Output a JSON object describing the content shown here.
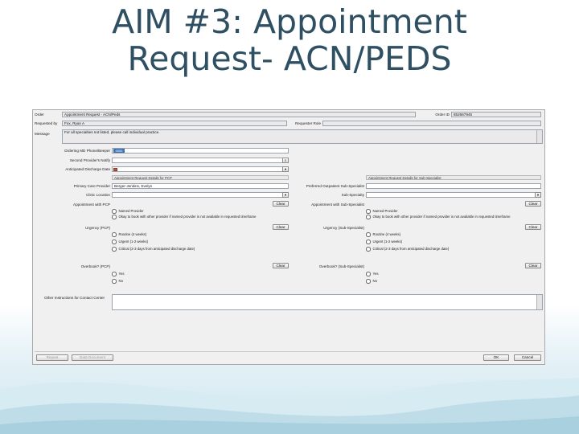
{
  "slide": {
    "title_line1": "AIM #3: Appointment",
    "title_line2": "Request- ACN/PEDS"
  },
  "form": {
    "order_label": "Order",
    "order_value": "Appointment Request - ACN/Peds",
    "order_id_label": "Order ID",
    "order_id_value": "852667945",
    "requested_by_label": "Requested by",
    "requested_by_value": "Fox, Ryan A",
    "requester_label": "Requester Role",
    "message_label": "Message",
    "message_value": "For all specialties not listed, please call individual practice.",
    "ordering_md_label": "Ordering MD Phone/Beeper",
    "ordering_md_value": "5555",
    "second_provider_label": "Second Provider's Notify",
    "anticipated_discharge_label": "Anticipated Discharge Date",
    "left_section_header": "Appointment Request Details for PCP",
    "right_section_header": "Appointment Request Details for Sub-Specialist",
    "pcp_label": "Primary Care Provider",
    "pcp_value": "Berger-Jenkins, Evelyn",
    "clinic_label": "Clinic Location",
    "pref_sub_label": "Preferred Outpatient Sub-Specialist",
    "sub_specialty_label": "Sub-Specialty",
    "appt_with_pcp_label": "Appointment with PCP",
    "appt_with_sub_label": "Appointment with Sub-Specialist",
    "clear_label": "Clear",
    "named_provider": "Named Provider",
    "left_okay_option": "Okay to book with other provider if named provider is not available in requested timeframe",
    "right_okay_option": "Okay to book with other provider if named provider is not available in requested timeframe",
    "urgency_pcp_label": "Urgency (PCP)",
    "urgency_sub_label": "Urgency (Sub-Specialist)",
    "left_routine": "Routine (4 weeks)",
    "left_urgent": "Urgent (1-2 weeks)",
    "left_critical": "Critical (2-3 days from anticipated discharge date)",
    "right_routine": "Routine (4 weeks)",
    "right_urgent": "Urgent (1-2 weeks)",
    "right_critical": "Critical (2-3 days from anticipated discharge date)",
    "overbook_pcp_label": "Overbook? (PCP)",
    "overbook_sub_label": "Overbook? (Sub-Specialist)",
    "yes": "Yes",
    "no": "No",
    "other_instructions_label": "Other Instructions for Contact Center",
    "repeat_label": "Repeat",
    "data_document_label": "Data Document",
    "ok_label": "OK",
    "cancel_label": "Cancel",
    "dropdown_glyph": "▾"
  },
  "colors": {
    "title": "#2f4f63",
    "window_bg": "#f0f0f0",
    "accent_badge": "#3a6fb5"
  }
}
